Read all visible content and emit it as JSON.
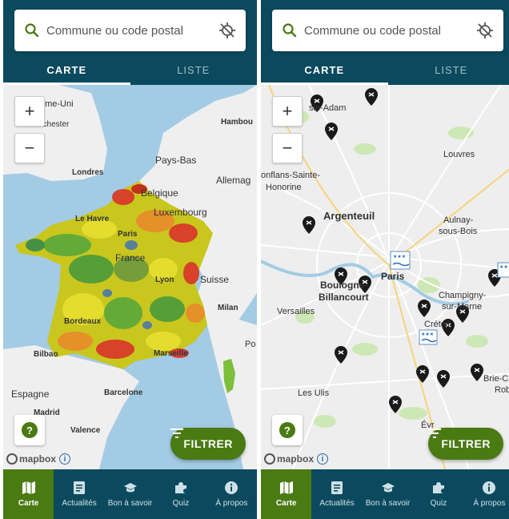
{
  "search": {
    "placeholder": "Commune ou code postal"
  },
  "tabs": [
    {
      "label": "CARTE"
    },
    {
      "label": "LISTE"
    }
  ],
  "zoom": {
    "in": "+",
    "out": "−"
  },
  "help": {
    "label": "?"
  },
  "filter": {
    "label": "FILTRER"
  },
  "attribution": {
    "logo": "mapbox",
    "info": "i"
  },
  "nav": [
    {
      "label": "Carte"
    },
    {
      "label": "Actualités"
    },
    {
      "label": "Bon à savoir"
    },
    {
      "label": "Quiz"
    },
    {
      "label": "À propos"
    }
  ],
  "map_left_labels": {
    "uk": "ume-Uni",
    "manchester": "nchester",
    "londres": "Londres",
    "hambourg": "Hambou",
    "paysbas": "Pays-Bas",
    "belgique": "Belgique",
    "allemagne": "Allemag",
    "lehavre": "Le Havre",
    "luxembourg": "Luxembourg",
    "paris": "Paris",
    "france": "France",
    "suisse": "Suisse",
    "lyon": "Lyon",
    "milan": "Milan",
    "bordeaux": "Bordeaux",
    "bilbao": "Bilbao",
    "marseille": "Marseille",
    "espagne": "Espagne",
    "madrid": "Madrid",
    "barcelone": "Barcelone",
    "valence": "Valence",
    "po": "Po"
  },
  "map_right_labels": {
    "isleadam": "sle-Adam",
    "louvres": "Louvres",
    "conflans": "onflans-Sainte-",
    "honorine": "Honorine",
    "argenteuil": "Argenteuil",
    "aulnay": "Aulnay-",
    "sousbois": "sous-Bois",
    "paris": "Paris",
    "boulogne": "Boulogne-",
    "billancourt": "Billancourt",
    "versailles": "Versailles",
    "champigny": "Champigny-",
    "surmarne": "sur-Marne",
    "creteil": "Créteil",
    "brie": "Brie-C",
    "rob": "Rob",
    "lesulis": "Les Ulis",
    "evry": "Évr"
  },
  "colors": {
    "header": "#0b4a5e",
    "accent_green": "#4a7a12",
    "sea": "#a3cbe4",
    "land": "#f2f2f2",
    "grid_marker": "#1a1a1a"
  }
}
